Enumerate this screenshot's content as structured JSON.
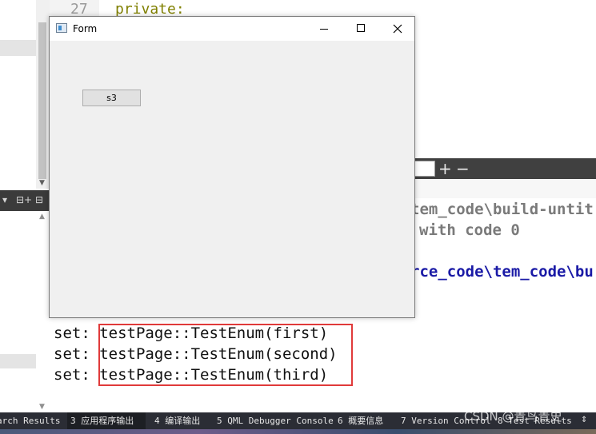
{
  "editor": {
    "line_number": "27",
    "code_line": "private:"
  },
  "output_toolbar": {
    "zoom_in_glyph": "+",
    "zoom_out_glyph": "−"
  },
  "left_pane_toolbar": {
    "dropdown_glyph": "▾",
    "split_glyph": "⊟+",
    "close_glyph": "⊟"
  },
  "output_lines": {
    "line1": "tem_code\\build-untit",
    "line2": "with code 0",
    "line3": "rce_code\\tem_code\\bu",
    "set1_prefix": "set: ",
    "set1_value": "testPage::TestEnum(first)",
    "set2_prefix": "set: ",
    "set2_value": "testPage::TestEnum(second)",
    "set3_prefix": "set: ",
    "set3_value": "testPage::TestEnum(third)"
  },
  "form_window": {
    "title": "Form",
    "button_label": "s3"
  },
  "bottom_tabs": {
    "search_results": "arch Results",
    "app_output": "3 应用程序输出",
    "compile_output": "4 编译输出",
    "qml_debugger": "5 QML Debugger Console",
    "overview": "6 概要信息",
    "version_control": "7 Version Control",
    "test_results": "8 Test Results",
    "arrows": "⇕"
  },
  "watermark": "CSDN @青鸟青史",
  "colors": {
    "highlight_box": "#e03a3a",
    "keyword": "#808000",
    "path_blue": "#1a1aa6"
  }
}
